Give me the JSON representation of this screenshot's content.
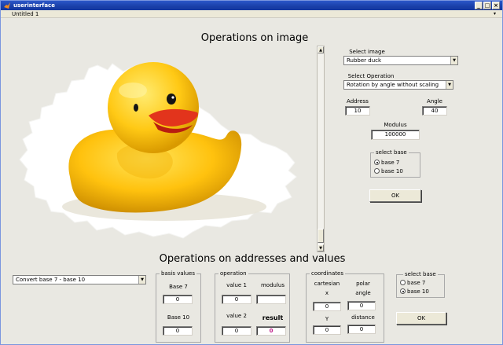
{
  "window": {
    "title": "userinterface",
    "menu_doc": "Untitled 1",
    "minimize": "_",
    "maximize": "□",
    "close": "×"
  },
  "image_section": {
    "heading": "Operations on image",
    "image_icon": "rubber-duck-image",
    "select_image_label": "Select image",
    "select_image_value": "Rubber duck",
    "select_operation_label": "Select Operation",
    "select_operation_value": "Rotation by angle without scaling",
    "address_label": "Address",
    "address_value": "10",
    "angle_label": "Angle",
    "angle_value": "40",
    "modulus_label": "Modulus",
    "modulus_value": "100000",
    "select_base_title": "select base",
    "base7_label": "base 7",
    "base10_label": "base 10",
    "selected_base": "base 7",
    "ok_label": "OK"
  },
  "addresses_section": {
    "heading": "Operations on addresses and values",
    "convert_value": "Convert base 7 - base 10",
    "basis": {
      "title": "basis values",
      "base7_label": "Base 7",
      "base7_value": "0",
      "base10_label": "Base 10",
      "base10_value": "0"
    },
    "operation": {
      "title": "operation",
      "value1_label": "value 1",
      "value1": "0",
      "modulus_label": "modulus",
      "modulus": "",
      "value2_label": "value 2",
      "value2": "0",
      "result_label": "result",
      "result": "0",
      "result_color": "#c0208a"
    },
    "coordinates": {
      "title": "coordinates",
      "cartesian_label": "cartesian",
      "polar_label": "polar",
      "x_label": "x",
      "x_value": "0",
      "angle_label": "angle",
      "angle_value": "0",
      "y_label": "Y",
      "y_value": "0",
      "distance_label": "distance",
      "distance_value": "0"
    },
    "select_base": {
      "title": "select base",
      "base7_label": "base 7",
      "base10_label": "base 10",
      "selected": "base 10"
    },
    "ok_label": "OK"
  }
}
